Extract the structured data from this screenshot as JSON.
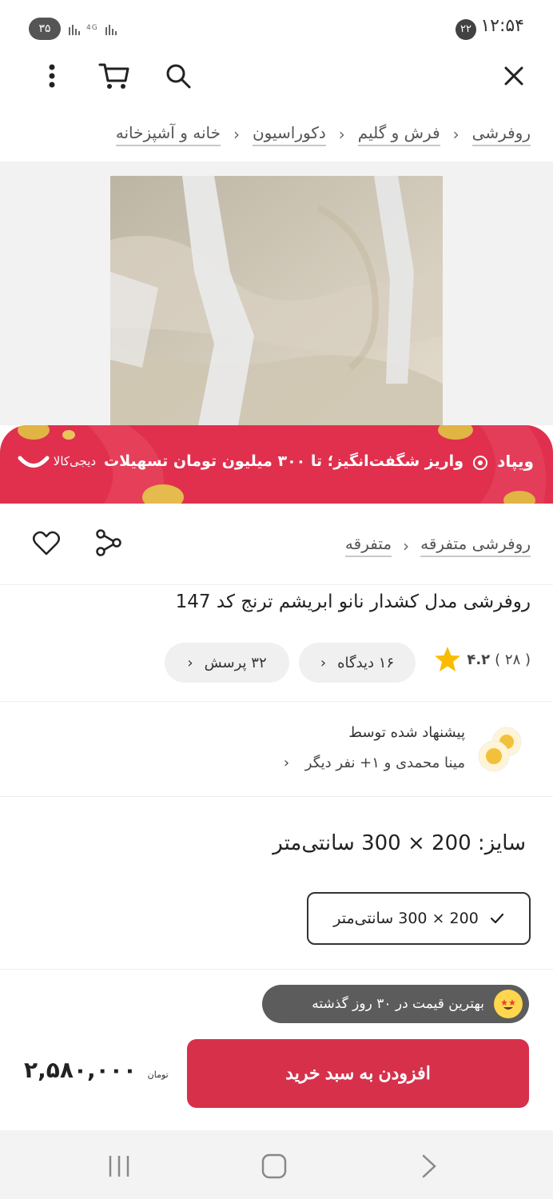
{
  "status_bar": {
    "time": "۱۲:۵۴",
    "notification_count": "۲۲",
    "battery": "۳۵",
    "signal_text": "4G"
  },
  "toolbar": {
    "close_icon": "close-icon",
    "search_icon": "search-icon",
    "cart_icon": "cart-icon",
    "more_icon": "more-vertical-icon"
  },
  "breadcrumb": [
    "خانه و آشپزخانه",
    "دکوراسیون",
    "فرش و گلیم",
    "روفرشی"
  ],
  "banner": {
    "brand": "ویپاد",
    "text": "واریز شگفت‌انگیز؛ تا ۳۰۰ میلیون تومان تسهیلات",
    "logo": "دیجی‌کالا",
    "bg_color": "#e0304e"
  },
  "category": [
    "متفرقه",
    "روفرشی متفرقه"
  ],
  "product": {
    "title": "روفرشی مدل کشدار نانو ابریشم ترنج کد 147",
    "rating": "۴.۲",
    "rating_count": "( ۲۸ )",
    "views_label": "۱۶ دیدگاه",
    "questions_label": "۳۲ پرسش"
  },
  "recommendation": {
    "title": "پیشنهاد شده توسط",
    "subtitle": "مینا محمدی و ۱+ نفر دیگر"
  },
  "size": {
    "label": "سایز: 200 × 300 سانتی‌متر",
    "option": "200 × 300 سانتی‌متر"
  },
  "best_price": {
    "text": "بهترین قیمت در ۳۰ روز گذشته"
  },
  "purchase": {
    "button_label": "افزودن به سبد خرید",
    "price": "۲,۵۸۰,۰۰۰",
    "currency": "تومان",
    "accent_color": "#d7304b"
  }
}
